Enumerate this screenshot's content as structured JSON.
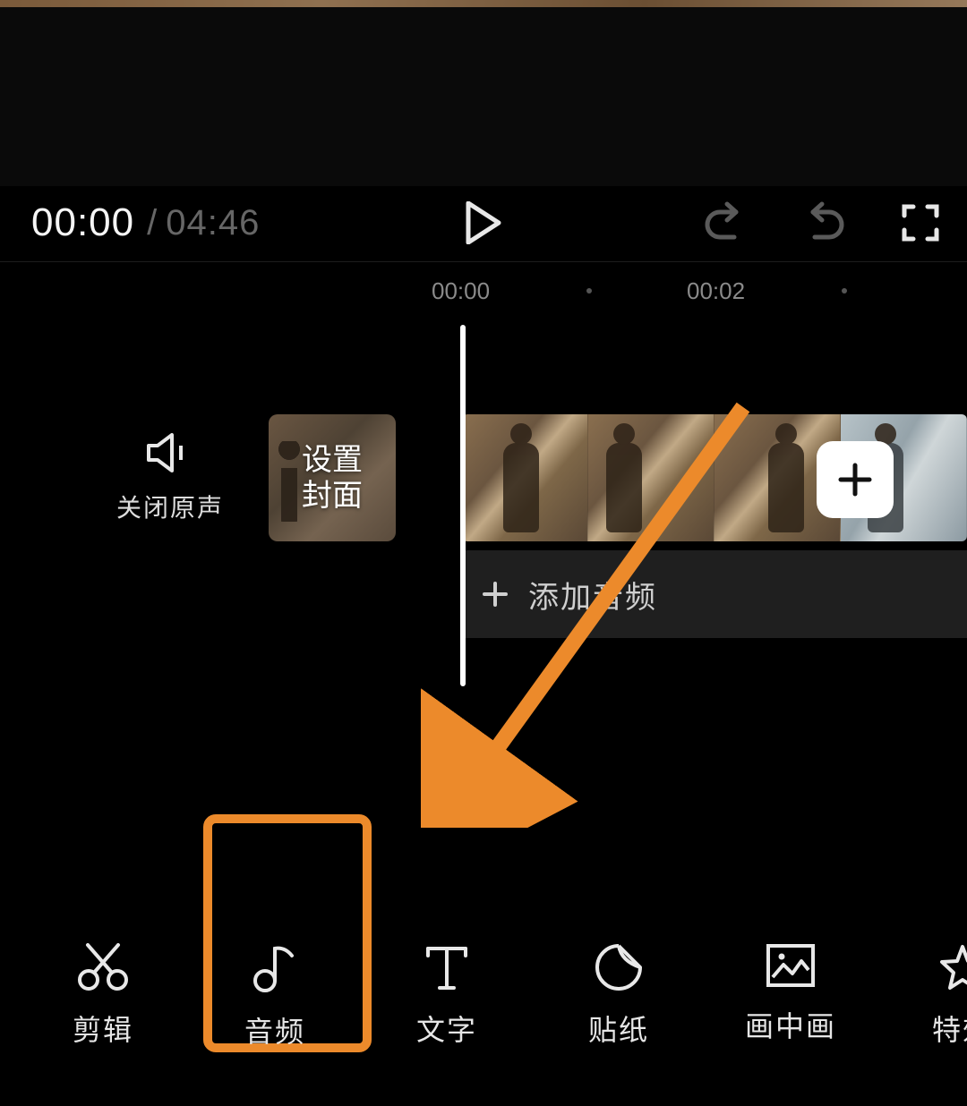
{
  "playbar": {
    "current_time": "00:00",
    "separator": "/",
    "total_time": "04:46"
  },
  "ruler": {
    "tick_labels": [
      "00:00",
      "00:02"
    ]
  },
  "mute": {
    "label": "关闭原声"
  },
  "cover": {
    "label": "设置\n封面"
  },
  "add_audio": {
    "label": "添加音频"
  },
  "tools": [
    {
      "id": "cut",
      "label": "剪辑"
    },
    {
      "id": "audio",
      "label": "音频"
    },
    {
      "id": "text",
      "label": "文字"
    },
    {
      "id": "sticker",
      "label": "贴纸"
    },
    {
      "id": "pip",
      "label": "画中画"
    },
    {
      "id": "effect",
      "label": "特效"
    }
  ],
  "colors": {
    "accent": "#ec8a2b"
  }
}
